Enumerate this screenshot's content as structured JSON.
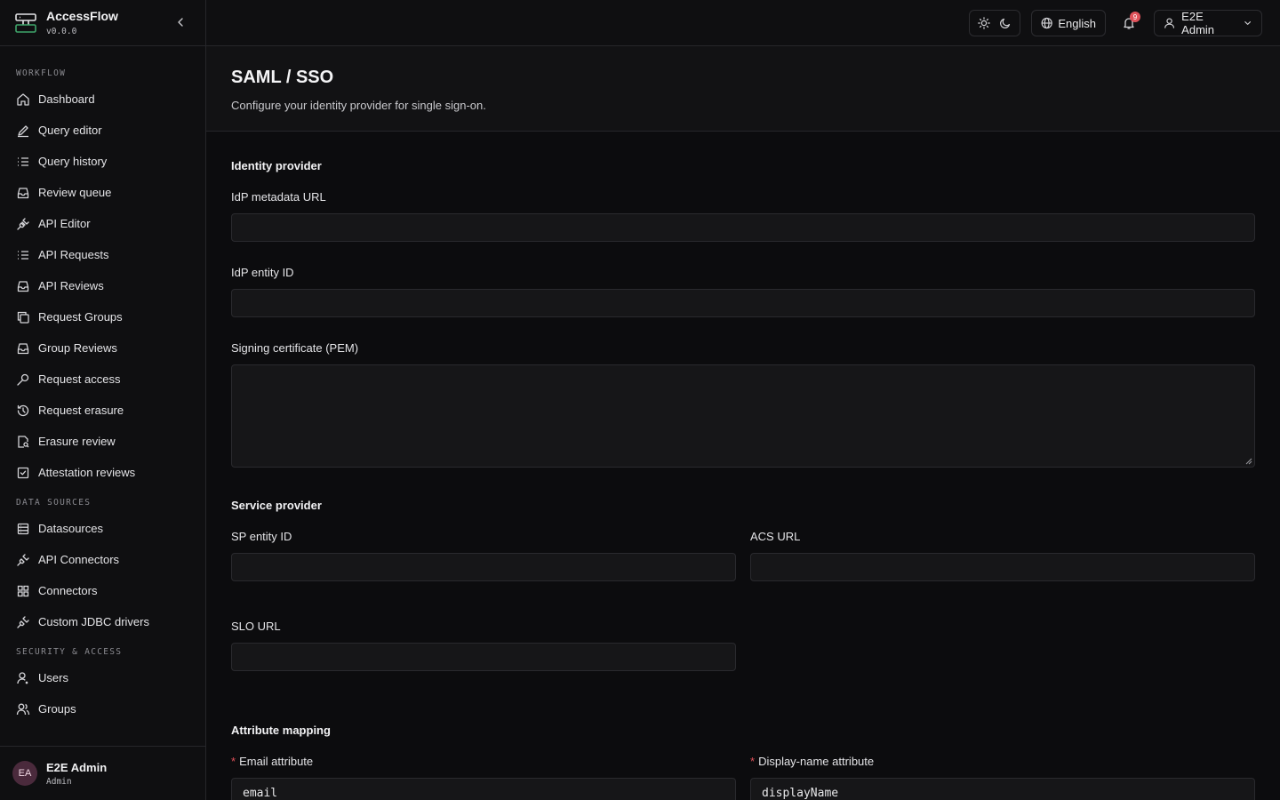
{
  "brand": {
    "name": "AccessFlow",
    "version": "v0.0.0"
  },
  "sidebar": {
    "sections": [
      {
        "title": "WORKFLOW",
        "items": [
          {
            "label": "Dashboard",
            "icon": "home-icon"
          },
          {
            "label": "Query editor",
            "icon": "pencil-icon"
          },
          {
            "label": "Query history",
            "icon": "list-icon"
          },
          {
            "label": "Review queue",
            "icon": "inbox-icon"
          },
          {
            "label": "API Editor",
            "icon": "plug-icon"
          },
          {
            "label": "API Requests",
            "icon": "list-icon"
          },
          {
            "label": "API Reviews",
            "icon": "inbox-icon"
          },
          {
            "label": "Request Groups",
            "icon": "copy-icon"
          },
          {
            "label": "Group Reviews",
            "icon": "inbox-icon"
          },
          {
            "label": "Request access",
            "icon": "key-icon"
          },
          {
            "label": "Request erasure",
            "icon": "history-icon"
          },
          {
            "label": "Erasure review",
            "icon": "file-search-icon"
          },
          {
            "label": "Attestation reviews",
            "icon": "check-square-icon"
          }
        ]
      },
      {
        "title": "DATA SOURCES",
        "items": [
          {
            "label": "Datasources",
            "icon": "database-icon"
          },
          {
            "label": "API Connectors",
            "icon": "plug-icon"
          },
          {
            "label": "Connectors",
            "icon": "grid-icon"
          },
          {
            "label": "Custom JDBC drivers",
            "icon": "plug-icon"
          }
        ]
      },
      {
        "title": "SECURITY & ACCESS",
        "items": [
          {
            "label": "Users",
            "icon": "user-cog-icon"
          },
          {
            "label": "Groups",
            "icon": "users-icon"
          }
        ]
      }
    ],
    "user": {
      "initials": "EA",
      "name": "E2E Admin",
      "role": "Admin"
    }
  },
  "topbar": {
    "language": "English",
    "notifications_count": "9",
    "user_name": "E2E Admin"
  },
  "page": {
    "title": "SAML / SSO",
    "subtitle": "Configure your identity provider for single sign-on."
  },
  "form": {
    "idp": {
      "title": "Identity provider",
      "metadata_url": {
        "label": "IdP metadata URL",
        "value": ""
      },
      "entity_id": {
        "label": "IdP entity ID",
        "value": ""
      },
      "certificate": {
        "label": "Signing certificate (PEM)",
        "value": ""
      }
    },
    "sp": {
      "title": "Service provider",
      "entity_id": {
        "label": "SP entity ID",
        "value": ""
      },
      "acs_url": {
        "label": "ACS URL",
        "value": ""
      },
      "slo_url": {
        "label": "SLO URL",
        "value": ""
      }
    },
    "mapping": {
      "title": "Attribute mapping",
      "required_marker": "*",
      "email": {
        "label": "Email attribute",
        "value": "email"
      },
      "display_name": {
        "label": "Display-name attribute",
        "value": "displayName"
      }
    }
  },
  "colors": {
    "accent_red": "#e0525a",
    "avatar_bg": "#4a2a3c",
    "logo_green": "#3fa56b"
  }
}
